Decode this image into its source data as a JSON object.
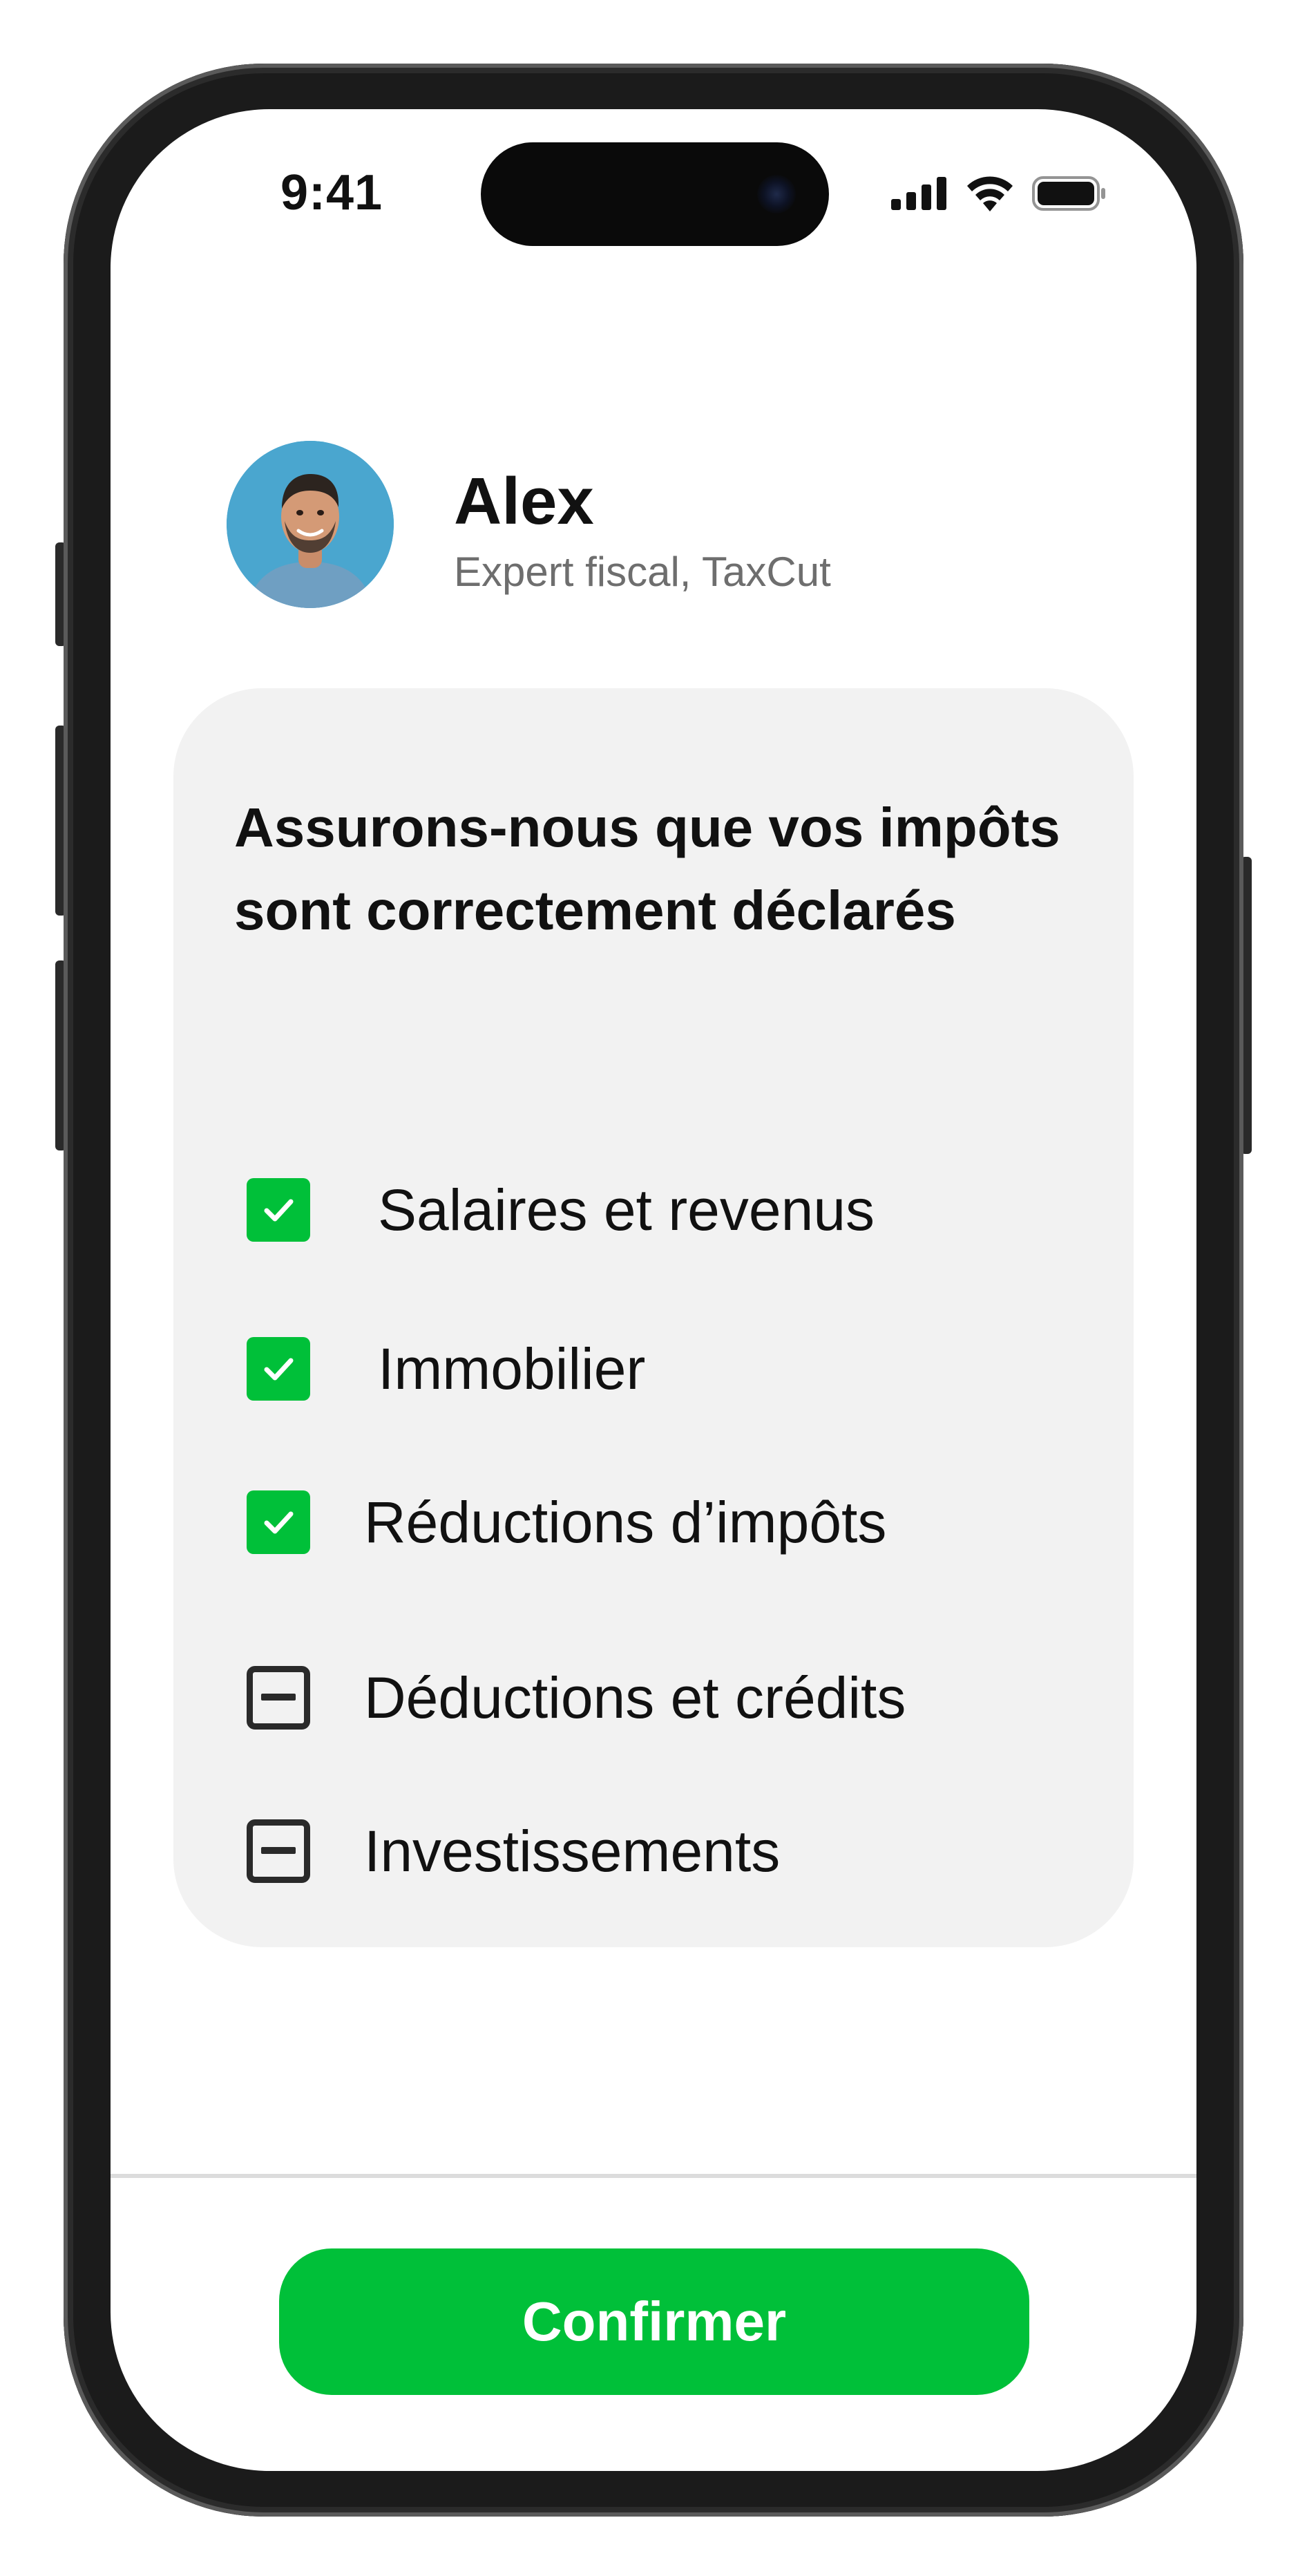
{
  "status_bar": {
    "time": "9:41",
    "icons": [
      "signal-icon",
      "wifi-icon",
      "battery-icon"
    ]
  },
  "advisor": {
    "name": "Alex",
    "role": "Expert fiscal, TaxCut"
  },
  "card": {
    "title": "Assurons-nous que vos impôts sont correctement déclarés",
    "items": [
      {
        "label": "Salaires et revenus",
        "state": "checked"
      },
      {
        "label": "Immobilier",
        "state": "checked"
      },
      {
        "label": "Réductions d’impôts",
        "state": "checked"
      },
      {
        "label": "Déductions et crédits",
        "state": "partial"
      },
      {
        "label": "Investissements",
        "state": "partial"
      }
    ]
  },
  "actions": {
    "confirm_label": "Confirmer"
  },
  "colors": {
    "accent": "#00c039",
    "card_bg": "#f2f2f2",
    "avatar_bg": "#4aa6cf"
  }
}
